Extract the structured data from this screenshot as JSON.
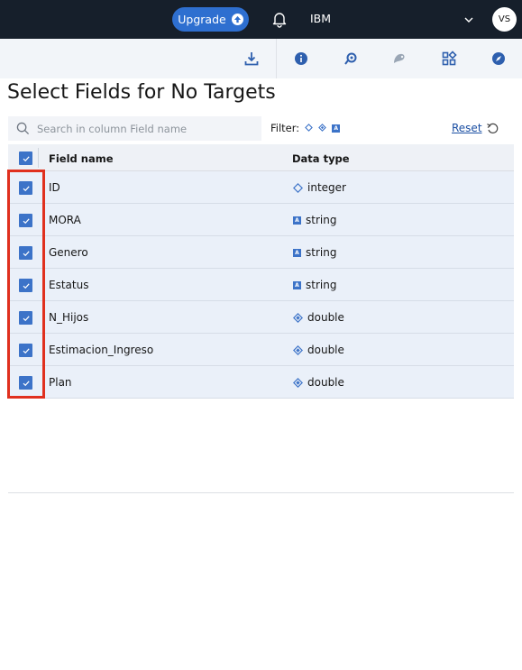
{
  "topbar": {
    "upgrade_label": "Upgrade",
    "org_name": "IBM",
    "avatar_initials": "VS"
  },
  "toolbar": {
    "icons": [
      "download-icon",
      "info-icon",
      "sync-icon",
      "palette-icon",
      "apps-icon",
      "compass-icon"
    ]
  },
  "page": {
    "title": "Select Fields for No Targets"
  },
  "search": {
    "placeholder": "Search in column Field name",
    "value": ""
  },
  "filter": {
    "label": "Filter:"
  },
  "reset": {
    "label": "Reset"
  },
  "table": {
    "columns": [
      "Field name",
      "Data type"
    ],
    "rows": [
      {
        "name": "ID",
        "type": "integer",
        "type_icon": "integer-icon"
      },
      {
        "name": "MORA",
        "type": "string",
        "type_icon": "string-icon"
      },
      {
        "name": "Genero",
        "type": "string",
        "type_icon": "string-icon"
      },
      {
        "name": "Estatus",
        "type": "string",
        "type_icon": "string-icon"
      },
      {
        "name": "N_Hijos",
        "type": "double",
        "type_icon": "double-icon"
      },
      {
        "name": "Estimacion_Ingreso",
        "type": "double",
        "type_icon": "double-icon"
      },
      {
        "name": "Plan",
        "type": "double",
        "type_icon": "double-icon"
      }
    ]
  },
  "colors": {
    "topbar": "#161f2b",
    "accent": "#3c73c8",
    "highlight": "#e0301e"
  }
}
